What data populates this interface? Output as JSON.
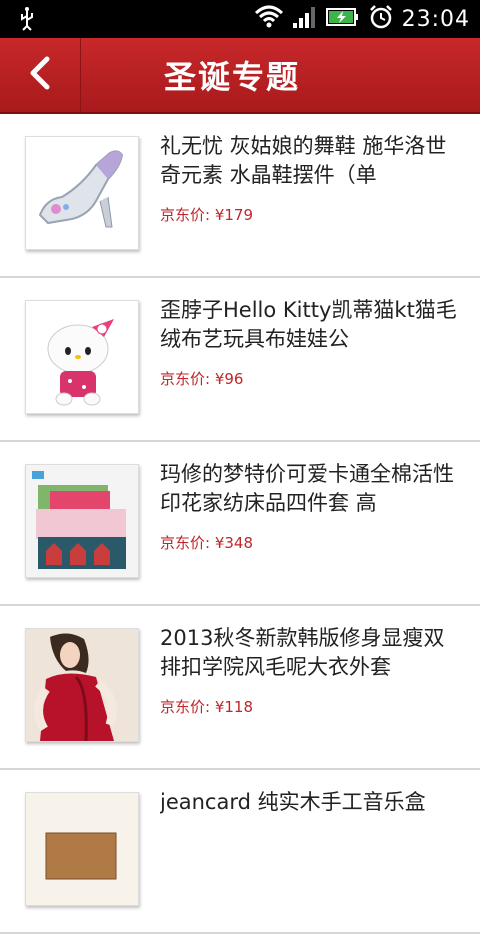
{
  "status": {
    "time": "23:04",
    "usb_icon": "usb-icon",
    "wifi_icon": "wifi-icon",
    "signal_icon": "signal-icon",
    "battery_icon": "battery-charging-icon",
    "alarm_icon": "alarm-icon"
  },
  "header": {
    "title": "圣诞专题",
    "back_icon": "chevron-left-icon"
  },
  "colors": {
    "header_red": "#b82022",
    "price_red": "#c0262a"
  },
  "products": [
    {
      "name": "礼无忧 灰姑娘的舞鞋 施华洛世奇元素 水晶鞋摆件（单",
      "price": "京东价: ¥179",
      "image": "crystal-shoe"
    },
    {
      "name": "歪脖子Hello Kitty凯蒂猫kt猫毛绒布艺玩具布娃娃公",
      "price": "京东价: ¥96",
      "image": "hello-kitty-plush"
    },
    {
      "name": "玛修的梦特价可爱卡通全棉活性印花家纺床品四件套 高",
      "price": "京东价: ¥348",
      "image": "bedding-set"
    },
    {
      "name": "2013秋冬新款韩版修身显瘦双排扣学院风毛呢大衣外套",
      "price": "京东价: ¥118",
      "image": "red-coat"
    },
    {
      "name": "jeancard 纯实木手工音乐盒",
      "price": "",
      "image": "music-box"
    }
  ]
}
